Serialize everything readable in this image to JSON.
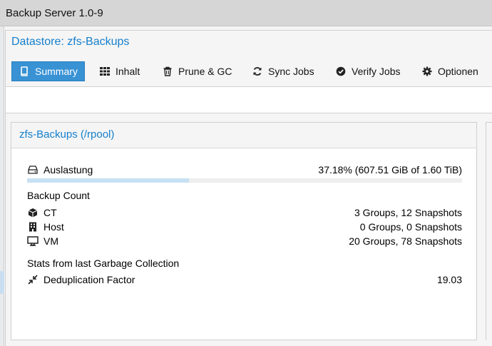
{
  "window": {
    "title": "Backup Server 1.0-9"
  },
  "datastore": {
    "title": "Datastore: zfs-Backups"
  },
  "tabs": [
    {
      "label": "Summary",
      "icon": "book-icon",
      "active": true
    },
    {
      "label": "Inhalt",
      "icon": "grid-icon",
      "active": false
    },
    {
      "label": "Prune & GC",
      "icon": "trash-icon",
      "active": false
    },
    {
      "label": "Sync Jobs",
      "icon": "refresh-icon",
      "active": false
    },
    {
      "label": "Verify Jobs",
      "icon": "check-circle-icon",
      "active": false
    },
    {
      "label": "Optionen",
      "icon": "gear-icon",
      "active": false
    }
  ],
  "summary": {
    "title": "zfs-Backups (/rpool)",
    "usage": {
      "label": "Auslastung",
      "value": "37.18% (607.51 GiB of 1.60 TiB)",
      "fraction": 0.3718,
      "icon": "hdd-icon"
    },
    "backup_count": {
      "heading": "Backup Count",
      "rows": [
        {
          "label": "CT",
          "value": "3 Groups, 12 Snapshots",
          "icon": "cube-icon"
        },
        {
          "label": "Host",
          "value": "0 Groups, 0 Snapshots",
          "icon": "building-icon"
        },
        {
          "label": "VM",
          "value": "20 Groups, 78 Snapshots",
          "icon": "desktop-icon"
        }
      ]
    },
    "gc": {
      "heading": "Stats from last Garbage Collection",
      "rows": [
        {
          "label": "Deduplication Factor",
          "value": "19.03",
          "icon": "compress-icon"
        }
      ]
    }
  },
  "colors": {
    "accent": "#157fcc",
    "active_tab": "#3892d4",
    "usage_fill": "#c7e0f4",
    "topbar": "#d6d6d6"
  }
}
